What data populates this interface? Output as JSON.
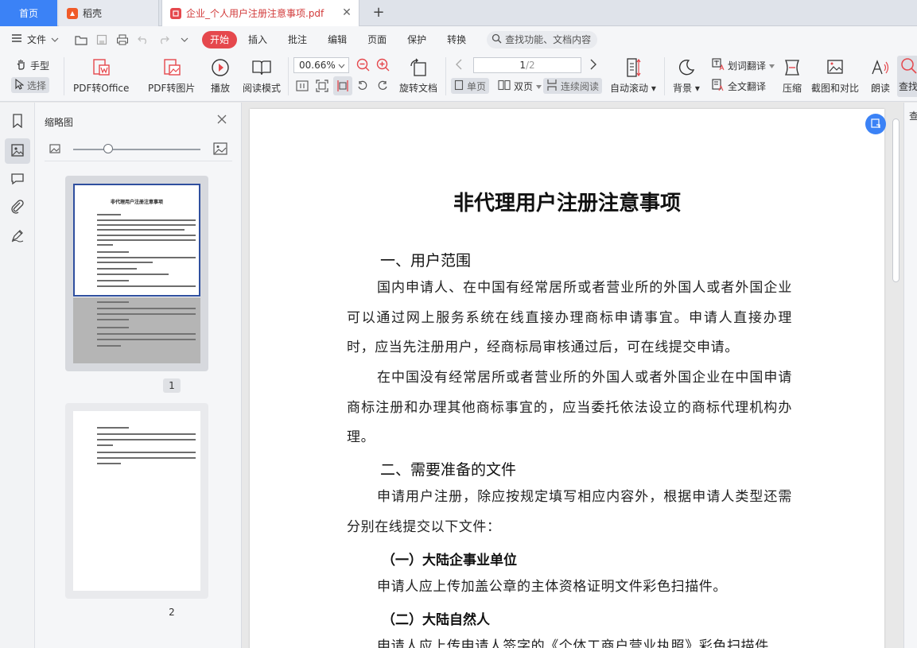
{
  "tabs": {
    "home": "首页",
    "inactive": "稻壳",
    "active": "企业_个人用户注册注意事项.pdf"
  },
  "menu": {
    "file": "文件",
    "tabs": [
      "开始",
      "插入",
      "批注",
      "编辑",
      "页面",
      "保护",
      "转换"
    ],
    "search": "查找功能、文档内容"
  },
  "ribbon": {
    "hand": "手型",
    "select": "选择",
    "pdf_to_office": "PDF转Office",
    "pdf_to_image": "PDF转图片",
    "play": "播放",
    "read_mode": "阅读模式",
    "zoom": "00.66%",
    "page_current": "1",
    "page_total": "/2",
    "rotate_doc": "旋转文档",
    "single": "单页",
    "double": "双页",
    "continuous": "连续阅读",
    "auto_scroll": "自动滚动",
    "background": "背景",
    "word_translate": "划词翻译",
    "full_translate": "全文翻译",
    "compress": "压缩",
    "screenshot_compare": "截图和对比",
    "read_aloud": "朗读",
    "find": "查找"
  },
  "thumb_panel": {
    "title": "缩略图",
    "page1_label": "1",
    "page2_label": "2",
    "mini_title": "非代理用户注册注意事项"
  },
  "document": {
    "title": "非代理用户注册注意事项",
    "h_scope": "一、用户范围",
    "p_scope_1": "国内申请人、在中国有经常居所或者营业所的外国人或者外国企业可以通过网上服务系统在线直接办理商标申请事宜。申请人直接办理时，应当先注册用户，经商标局审核通过后，可在线提交申请。",
    "p_scope_2": "在中国没有经常居所或者营业所的外国人或者外国企业在中国申请商标注册和办理其他商标事宜的，应当委托依法设立的商标代理机构办理。",
    "h_files": "二、需要准备的文件",
    "p_files": "申请用户注册，除应按规定填写相应内容外，根据申请人类型还需分别在线提交以下文件：",
    "h_enterprise": "（一）大陆企事业单位",
    "p_enterprise": "申请人应上传加盖公章的主体资格证明文件彩色扫描件。",
    "h_person": "（二）大陆自然人",
    "p_person": "申请人应上传申请人签字的《个体工商户营业执照》彩色扫描件"
  },
  "right_panel": {
    "label": "查"
  }
}
